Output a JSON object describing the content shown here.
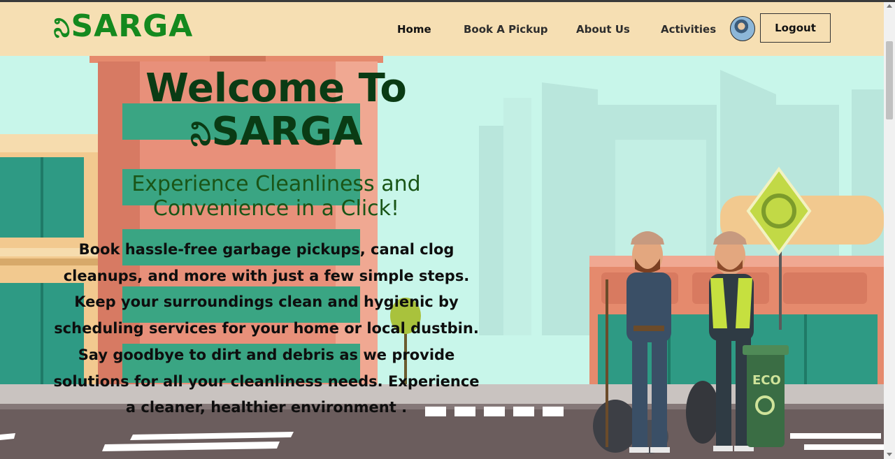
{
  "brand": {
    "logo_text": "ನಿSARGA",
    "colors": {
      "brand_green": "#14891e",
      "nav_bg": "#f6dfb3",
      "hero_heading": "#0a3b14"
    }
  },
  "nav": {
    "links": [
      "Home",
      "Book A Pickup",
      "About Us",
      "Activities"
    ],
    "logout_label": "Logout",
    "avatar_icon": "user-avatar-icon"
  },
  "hero": {
    "welcome_line1": "Welcome To",
    "welcome_line2": "ನಿSARGA",
    "tagline": "Experience Cleanliness and Convenience in a Click!",
    "body": "Book hassle-free garbage pickups, canal clog cleanups, and more with just a few simple steps. Keep your surroundings clean and hygienic by scheduling services for your home or local dustbin. Say goodbye to dirt and debris as we provide solutions for all your cleanliness needs. Experience a cleaner, healthier environment .",
    "bin_label": "ECO"
  }
}
